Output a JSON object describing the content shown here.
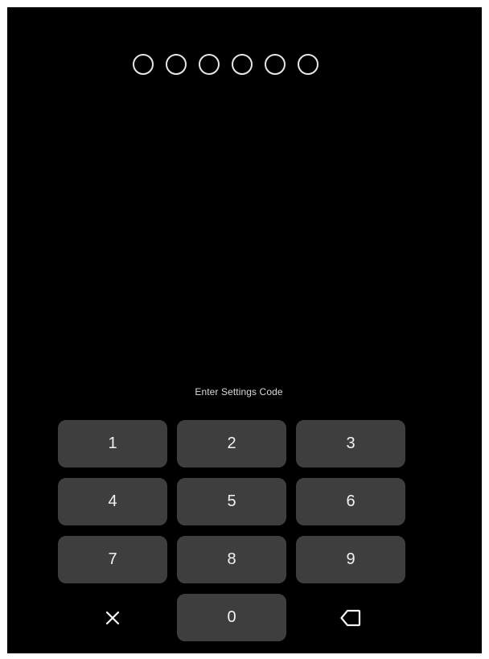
{
  "pin": {
    "length": 6,
    "entered": 0
  },
  "prompt": "Enter Settings Code",
  "keypad": {
    "keys": [
      {
        "label": "1"
      },
      {
        "label": "2"
      },
      {
        "label": "3"
      },
      {
        "label": "4"
      },
      {
        "label": "5"
      },
      {
        "label": "6"
      },
      {
        "label": "7"
      },
      {
        "label": "8"
      },
      {
        "label": "9"
      },
      {
        "icon": "close-icon"
      },
      {
        "label": "0"
      },
      {
        "icon": "backspace-icon"
      }
    ]
  },
  "colors": {
    "background": "#000000",
    "key_background": "#3e3e3e",
    "text": "#f2f2f2"
  }
}
